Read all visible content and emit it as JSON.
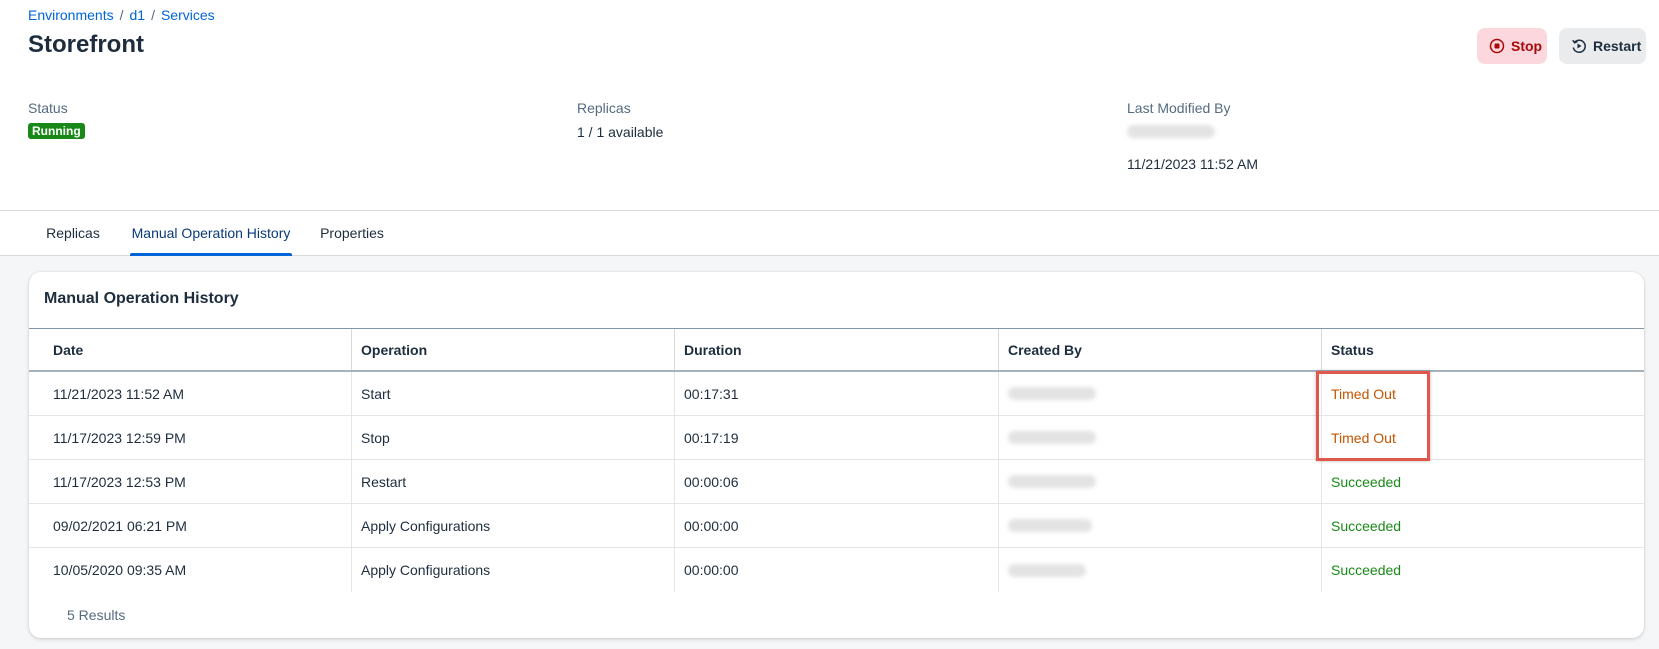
{
  "breadcrumb": {
    "items": [
      "Environments",
      "d1",
      "Services"
    ],
    "separator": "/"
  },
  "page": {
    "title": "Storefront"
  },
  "actions": {
    "stop_label": "Stop",
    "restart_label": "Restart"
  },
  "attributes": {
    "status": {
      "label": "Status",
      "value": "Running"
    },
    "replicas": {
      "label": "Replicas",
      "value": "1 / 1 available"
    },
    "last_modified": {
      "label": "Last Modified By",
      "timestamp": "11/21/2023 11:52 AM"
    }
  },
  "tabs": [
    {
      "label": "Replicas",
      "active": false
    },
    {
      "label": "Manual Operation History",
      "active": true
    },
    {
      "label": "Properties",
      "active": false
    }
  ],
  "card": {
    "title": "Manual Operation History",
    "columns": [
      "Date",
      "Operation",
      "Duration",
      "Created By",
      "Status"
    ],
    "rows": [
      {
        "date": "11/21/2023 11:52 AM",
        "operation": "Start",
        "duration": "00:17:31",
        "status": "Timed Out"
      },
      {
        "date": "11/17/2023 12:59 PM",
        "operation": "Stop",
        "duration": "00:17:19",
        "status": "Timed Out"
      },
      {
        "date": "11/17/2023 12:53 PM",
        "operation": "Restart",
        "duration": "00:00:06",
        "status": "Succeeded"
      },
      {
        "date": "09/02/2021 06:21 PM",
        "operation": "Apply Configurations",
        "duration": "00:00:00",
        "status": "Succeeded"
      },
      {
        "date": "10/05/2020 09:35 AM",
        "operation": "Apply Configurations",
        "duration": "00:00:00",
        "status": "Succeeded"
      }
    ],
    "results": "5 Results"
  },
  "colors": {
    "accent": "#0064d9",
    "running_badge": "#188918",
    "timed_out": "#c35500",
    "succeeded": "#188918",
    "highlight_box": "#e0574b"
  },
  "icons": {
    "stop": "stop-circle-icon",
    "restart": "restart-icon"
  }
}
